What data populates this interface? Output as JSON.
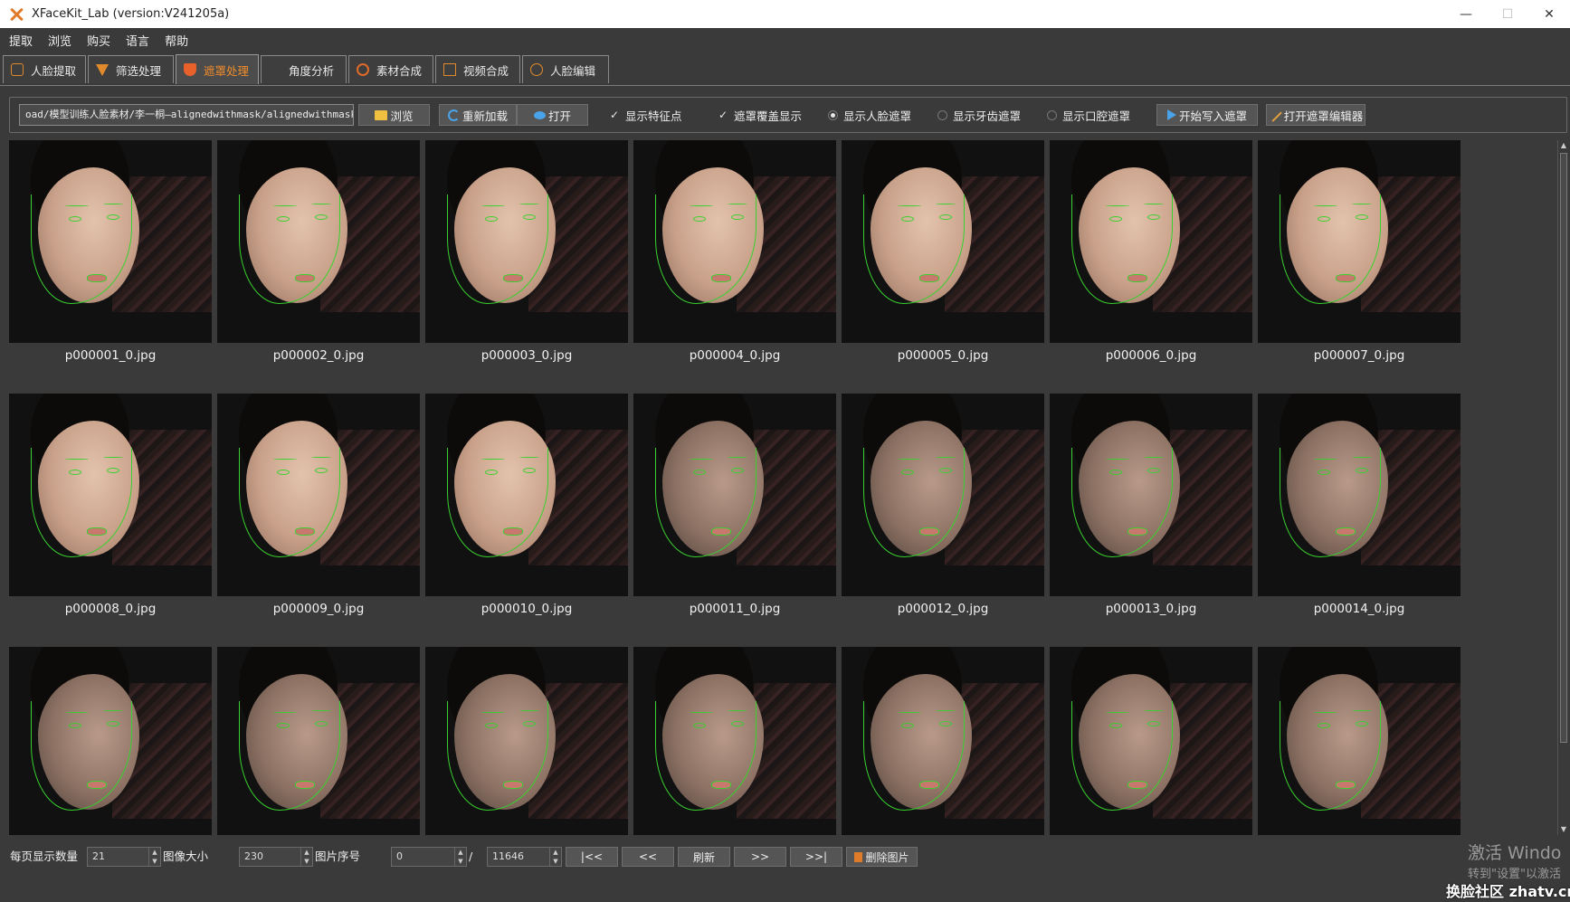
{
  "window": {
    "title": "XFaceKit_Lab (version:V241205a)",
    "minimize": "—",
    "restore": "☐",
    "close": "✕"
  },
  "menu": [
    "提取",
    "浏览",
    "购买",
    "语言",
    "帮助"
  ],
  "tabs": [
    {
      "label": "人脸提取",
      "icon": "face-icon"
    },
    {
      "label": "筛选处理",
      "icon": "filter-icon"
    },
    {
      "label": "遮罩处理",
      "icon": "mask-icon",
      "active": true
    },
    {
      "label": "角度分析",
      "icon": "grid-icon"
    },
    {
      "label": "素材合成",
      "icon": "merge-icon"
    },
    {
      "label": "视频合成",
      "icon": "film-icon"
    },
    {
      "label": "人脸编辑",
      "icon": "edit-icon"
    }
  ],
  "toolbar": {
    "path_value": "oad/模型训练人脸素材/李一桐—alignedwithmask/alignedwithmask",
    "browse": "浏览",
    "reload": "重新加载",
    "open": "打开",
    "show_landmarks": "显示特征点",
    "show_landmarks_checked": "✓",
    "mask_overlay": "遮罩覆盖显示",
    "mask_overlay_checked": "✓",
    "radio_face_mask": "显示人脸遮罩",
    "radio_teeth_mask": "显示牙齿遮罩",
    "radio_mouth_mask": "显示口腔遮罩",
    "start_write_mask": "开始写入遮罩",
    "open_mask_editor": "打开遮罩编辑器"
  },
  "thumbnails": [
    {
      "caption": "p000001_0.jpg"
    },
    {
      "caption": "p000002_0.jpg"
    },
    {
      "caption": "p000003_0.jpg"
    },
    {
      "caption": "p000004_0.jpg"
    },
    {
      "caption": "p000005_0.jpg"
    },
    {
      "caption": "p000006_0.jpg"
    },
    {
      "caption": "p000007_0.jpg"
    },
    {
      "caption": "p000008_0.jpg"
    },
    {
      "caption": "p000009_0.jpg"
    },
    {
      "caption": "p000010_0.jpg"
    },
    {
      "caption": "p000011_0.jpg"
    },
    {
      "caption": "p000012_0.jpg"
    },
    {
      "caption": "p000013_0.jpg"
    },
    {
      "caption": "p000014_0.jpg"
    },
    {
      "caption": ""
    },
    {
      "caption": ""
    },
    {
      "caption": ""
    },
    {
      "caption": ""
    },
    {
      "caption": ""
    },
    {
      "caption": ""
    },
    {
      "caption": ""
    }
  ],
  "bottom": {
    "per_page_label": "每页显示数量",
    "per_page_value": "21",
    "image_size_label": "图像大小",
    "image_size_value": "230",
    "image_index_label": "图片序号",
    "image_index_value": "0",
    "slash": "/",
    "total_value": "11646",
    "first": "|<<",
    "prev": "<<",
    "refresh": "刷新",
    "next": ">>",
    "last": ">>|",
    "delete": "删除图片"
  },
  "overlay": {
    "activate_windows": "激活 Windo",
    "activate_hint": "转到\"设置\"以激活",
    "site": "换脸社区 zhatv.cn"
  },
  "colors": {
    "accent": "#f08c2a",
    "landmark": "#39d12f",
    "background": "#3a3a3a"
  }
}
